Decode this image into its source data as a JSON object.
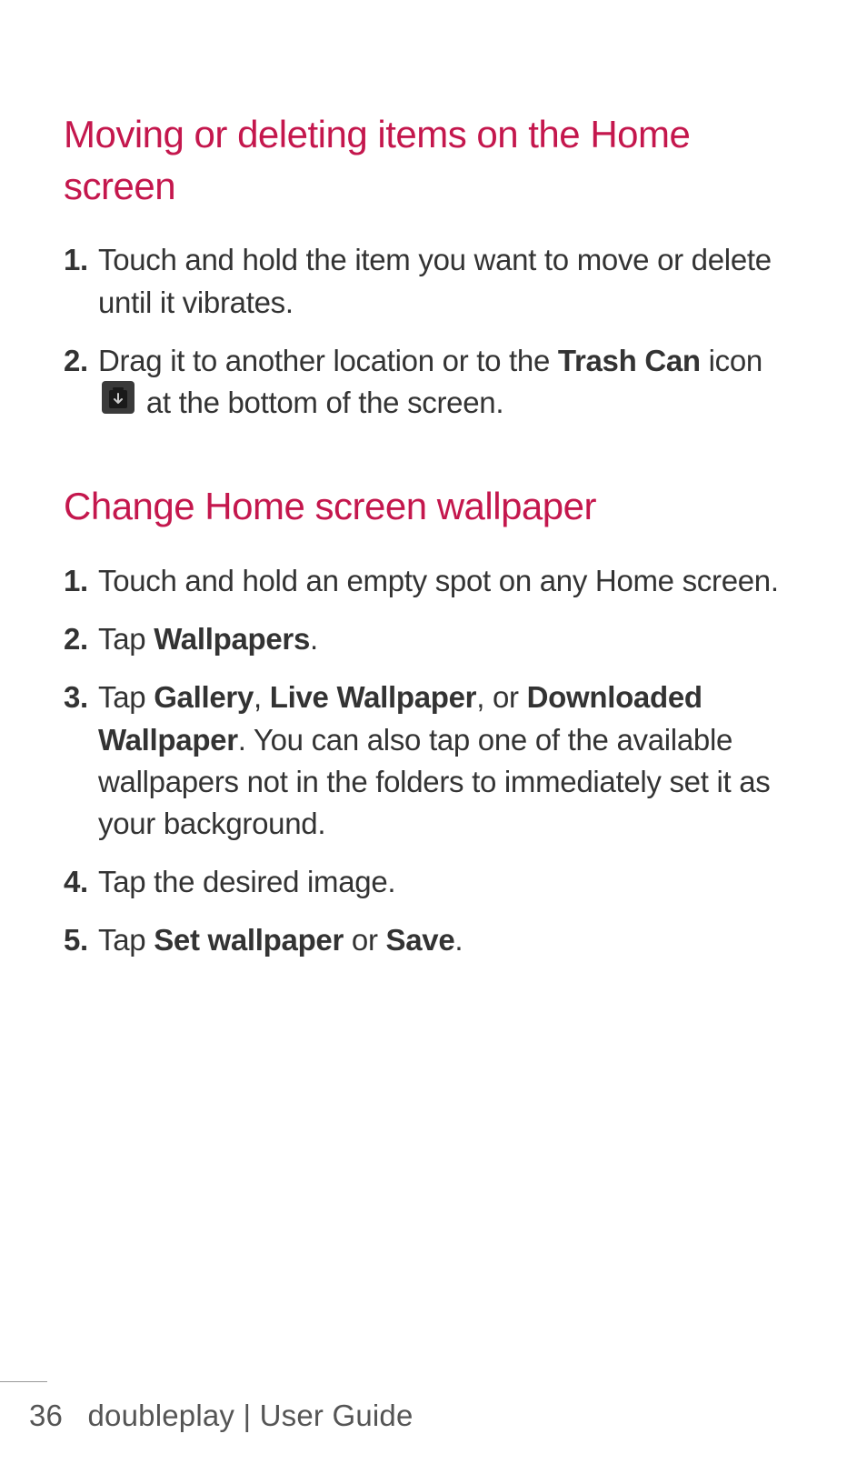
{
  "section1": {
    "heading": "Moving or deleting items on the Home screen",
    "items": [
      {
        "num": "1.",
        "text_a": "Touch and hold the item you want to move or delete until it vibrates."
      },
      {
        "num": "2.",
        "text_a": "Drag it to another location or to the ",
        "bold_a": "Trash Can",
        "text_b": " icon ",
        "text_c": " at the bottom of the screen."
      }
    ]
  },
  "section2": {
    "heading": "Change Home screen wallpaper",
    "items": [
      {
        "num": "1.",
        "text_a": "Touch and hold an empty spot on any Home screen."
      },
      {
        "num": "2.",
        "text_a": "Tap ",
        "bold_a": "Wallpapers",
        "text_b": "."
      },
      {
        "num": "3.",
        "text_a": "Tap ",
        "bold_a": "Gallery",
        "text_b": ", ",
        "bold_b": "Live Wallpaper",
        "text_c": ", or ",
        "bold_c": "Downloaded Wallpaper",
        "text_d": ". You can also tap one of the available wallpapers not in the folders to immediately set it as your background."
      },
      {
        "num": "4.",
        "text_a": "Tap the desired image."
      },
      {
        "num": "5.",
        "text_a": "Tap ",
        "bold_a": "Set wallpaper",
        "text_b": " or ",
        "bold_b": "Save",
        "text_c": "."
      }
    ]
  },
  "footer": {
    "page": "36",
    "label": "doubleplay  |  User Guide"
  }
}
